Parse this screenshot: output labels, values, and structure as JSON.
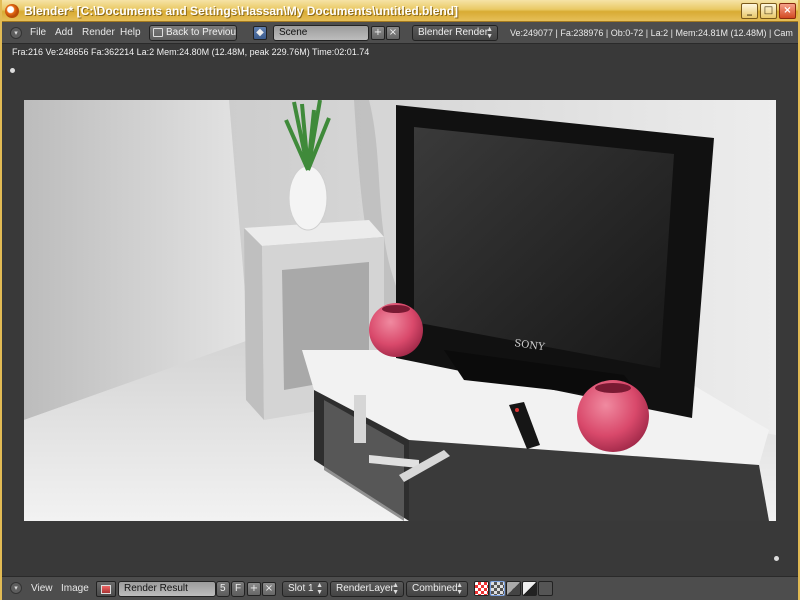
{
  "window": {
    "title": "Blender* [C:\\Documents and Settings\\Hassan\\My Documents\\untitled.blend]",
    "minimize": "_",
    "maximize": "□",
    "close": "×"
  },
  "info_header": {
    "menus": [
      "File",
      "Add",
      "Render",
      "Help"
    ],
    "back_button": "Back to Previous",
    "scene": "Scene",
    "add_glyph": "+",
    "remove_glyph": "×",
    "render_engine": "Blender Render",
    "stats": "Ve:249077 | Fa:238976 | Ob:0-72 | La:2 | Mem:24.81M (12.48M) | Cam"
  },
  "image_editor": {
    "render_info": "Fra:216  Ve:248656 Fa:362214 La:2 Mem:24.80M (12.48M, peak 229.76M) Time:02:01.74",
    "tv_brand": "SONY"
  },
  "bottom_header": {
    "menus": [
      "View",
      "Image"
    ],
    "image_name": "Render Result",
    "users": "5",
    "fake_user": "F",
    "add_glyph": "+",
    "remove_glyph": "×",
    "slot": "Slot 1",
    "layer": "RenderLayer",
    "pass": "Combined"
  },
  "colors": {
    "titlebar": "#e9c964",
    "header": "#4d4d4d",
    "vase_pink": "#d9496b",
    "tv_black": "#141414"
  },
  "icons": [
    "blender-icon",
    "editor-type-icon",
    "back-icon",
    "scene-icon",
    "image-icon",
    "channel-icon"
  ]
}
